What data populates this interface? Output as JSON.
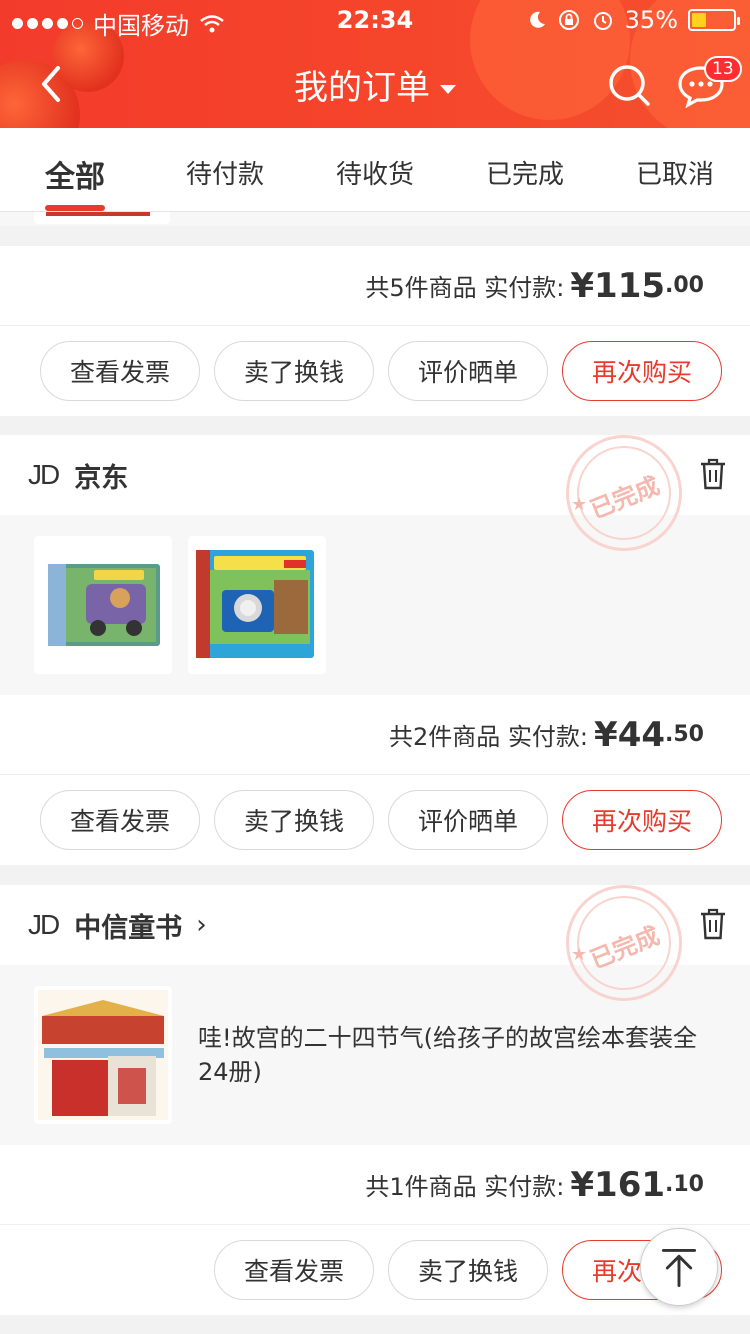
{
  "status_bar": {
    "carrier": "中国移动",
    "time": "22:34",
    "battery": "35%"
  },
  "header": {
    "title": "我的订单",
    "message_badge": "13"
  },
  "tabs": [
    {
      "label": "全部",
      "active": true
    },
    {
      "label": "待付款"
    },
    {
      "label": "待收货"
    },
    {
      "label": "已完成"
    },
    {
      "label": "已取消"
    }
  ],
  "orders": [
    {
      "count_text": "共5件商品",
      "paid_label": "实付款:",
      "amount_yuan": "¥115",
      "amount_cents": ".00",
      "buttons": [
        "查看发票",
        "卖了换钱",
        "评价晒单",
        "再次购买"
      ]
    },
    {
      "shop_logo": "JD",
      "shop_name": "京东",
      "stamp": "已完成",
      "count_text": "共2件商品",
      "paid_label": "实付款:",
      "amount_yuan": "¥44",
      "amount_cents": ".50",
      "buttons": [
        "查看发票",
        "卖了换钱",
        "评价晒单",
        "再次购买"
      ]
    },
    {
      "shop_logo": "JD",
      "shop_name": "中信童书",
      "stamp": "已完成",
      "product_name": "哇!故宫的二十四节气(给孩子的故宫绘本套装全24册)",
      "count_text": "共1件商品",
      "paid_label": "实付款:",
      "amount_yuan": "¥161",
      "amount_cents": ".10",
      "buttons": [
        "查看发票",
        "卖了换钱",
        "再次购买"
      ]
    }
  ],
  "colors": {
    "header": "#f33b2b",
    "accent": "#e93a2d"
  }
}
